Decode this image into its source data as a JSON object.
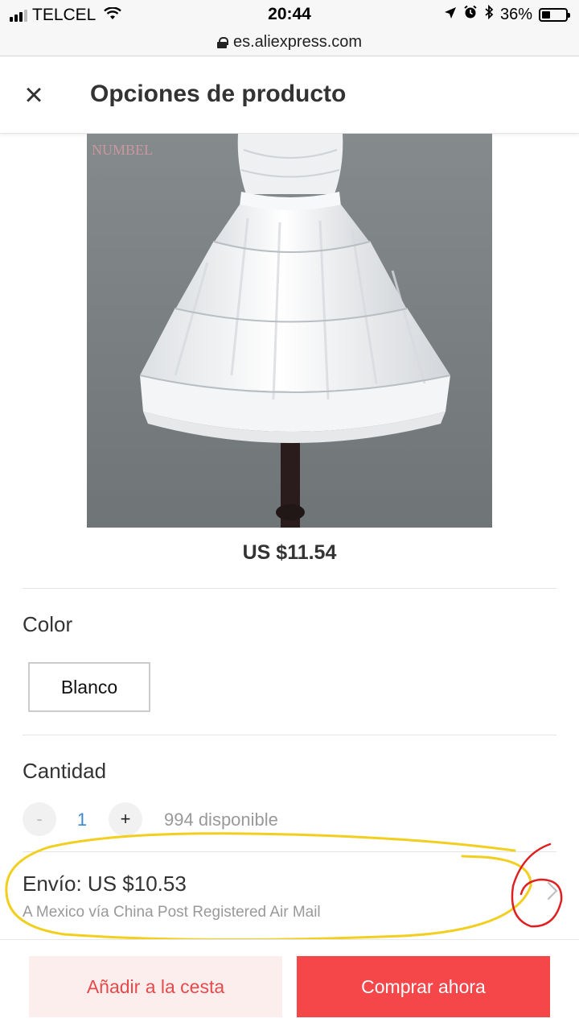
{
  "status_bar": {
    "carrier": "TELCEL",
    "time": "20:44",
    "battery": "36%",
    "battery_level": 0.36,
    "icons": [
      "signal-icon",
      "wifi-icon",
      "location-arrow-icon",
      "alarm-icon",
      "bluetooth-icon",
      "battery-icon"
    ]
  },
  "browser": {
    "url": "es.aliexpress.com"
  },
  "header": {
    "close_icon": "×",
    "title": "Opciones de producto"
  },
  "product": {
    "image_watermark": "NUMBEL",
    "price": "US $11.54"
  },
  "color": {
    "label": "Color",
    "selected": "Blanco"
  },
  "quantity": {
    "label": "Cantidad",
    "minus": "-",
    "value": "1",
    "plus": "+",
    "available": "994 disponible"
  },
  "shipping": {
    "title": "Envío: US $10.53",
    "method": "A Mexico vía China Post Registered Air Mail"
  },
  "annotation": {
    "handwritten_number": "6",
    "ellipse_color": "#f2cf1f",
    "number_color": "#e02020"
  },
  "actions": {
    "add_to_cart": "Añadir a la cesta",
    "buy_now": "Comprar ahora"
  },
  "colors": {
    "accent_red": "#f5464a",
    "cart_bg": "#fdeeee",
    "qty_blue": "#3a8ad0"
  }
}
